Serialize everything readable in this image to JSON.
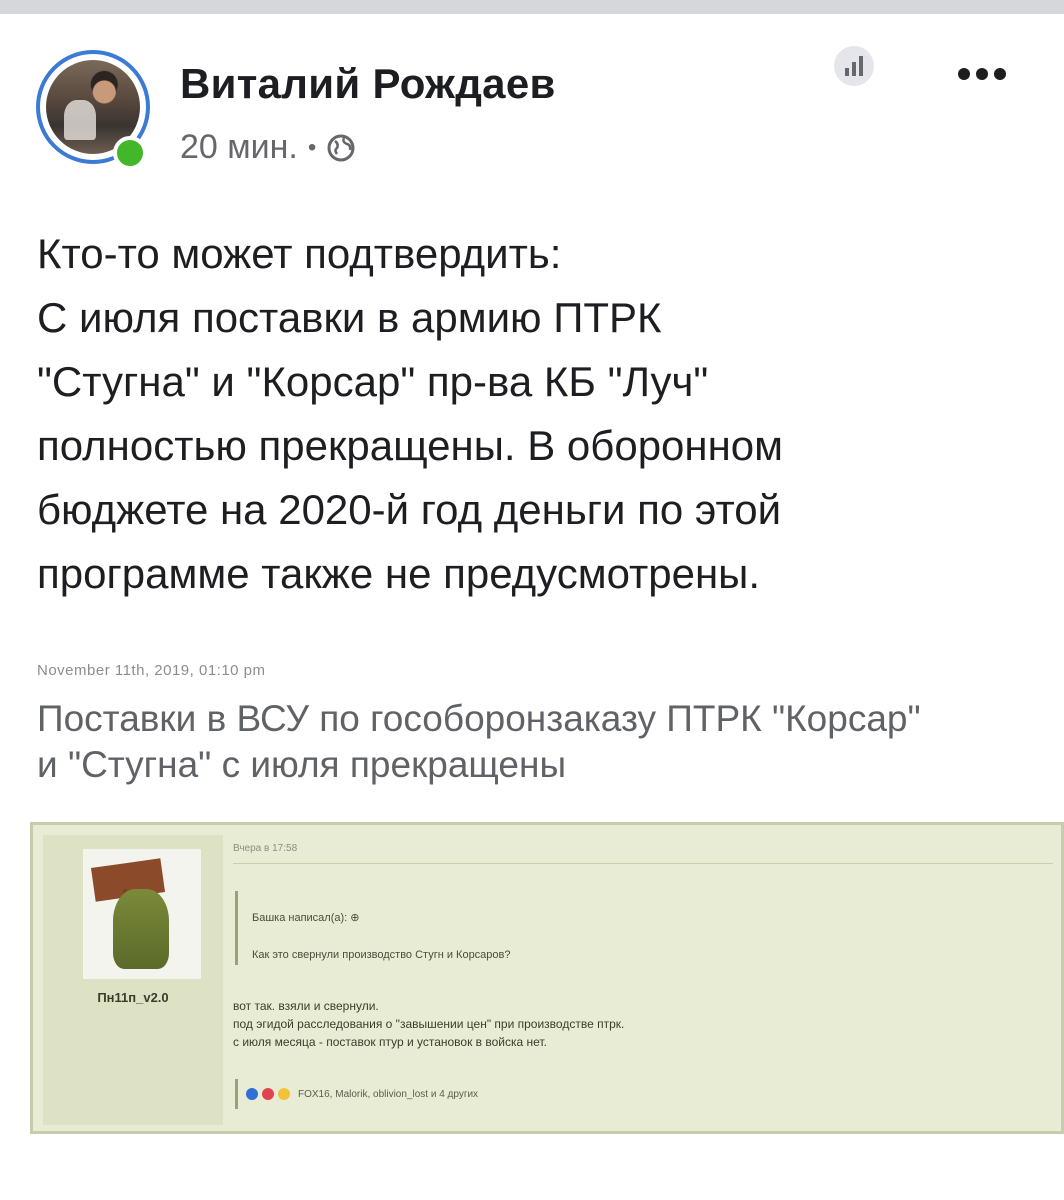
{
  "post": {
    "author": "Виталий Рождаев",
    "time": "20 мин.",
    "separator": "•",
    "audience_icon": "globe-icon",
    "text_lines": [
      "Кто-то может подтвердить:",
      "С июля поставки в армию ПТРК",
      "\"Стугна\" и \"Корсар\" пр-ва КБ \"Луч\"",
      "полностью прекращены. В оборонном",
      "бюджете на 2020-й год деньги по этой",
      "программе также не предусмотрены."
    ]
  },
  "article": {
    "date": "November 11th, 2019, 01:10 pm",
    "title_lines": [
      "Поставки в ВСУ по гособоронзаказу ПТРК \"Корсар\"",
      "и \"Стугна\" с июля прекращены"
    ]
  },
  "forum": {
    "username": "Пн11п_v2.0",
    "timestamp": "Вчера в 17:58",
    "quote_author": "Башка написал(а): ⊕",
    "quote_text": "Как это свернули производство Стугн и Корсаров?",
    "reply_lines": [
      "вот так. взяли и свернули.",
      "под эгидой расследования о \"завышении цен\" при производстве птрк.",
      "с июля месяца - поставок птур и установок в войска нет."
    ],
    "reactions_text": "FOX16, Malorik, oblivion_lost и 4 других"
  },
  "colors": {
    "accent": "#3b7bd6",
    "online": "#42b72a",
    "forum_bg": "#e9ecd4"
  }
}
